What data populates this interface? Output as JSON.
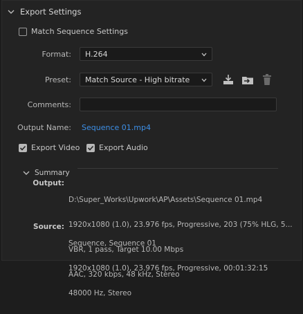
{
  "section_title": "Export Settings",
  "match_sequence": {
    "label": "Match Sequence Settings",
    "checked": false
  },
  "format": {
    "label": "Format:",
    "value": "H.264"
  },
  "preset": {
    "label": "Preset:",
    "value": "Match Source - High bitrate"
  },
  "comments": {
    "label": "Comments:",
    "value": ""
  },
  "output_name": {
    "label": "Output Name:",
    "value": "Sequence 01.mp4"
  },
  "export_video": {
    "label": "Export Video",
    "checked": true
  },
  "export_audio": {
    "label": "Export Audio",
    "checked": true
  },
  "summary": {
    "title": "Summary",
    "output_label": "Output:",
    "output_lines": [
      "D:\\Super_Works\\Upwork\\AP\\Assets\\Sequence 01.mp4",
      "1920x1080 (1.0), 23.976 fps, Progressive, 203 (75% HLG, 5...",
      "VBR, 1 pass, Target 10.00 Mbps",
      "AAC, 320 kbps, 48 kHz, Stereo"
    ],
    "source_label": "Source:",
    "source_lines": [
      "Sequence, Sequence 01",
      "1920x1080 (1.0), 23.976 fps, Progressive, 00:01:32:15",
      "48000 Hz, Stereo"
    ]
  },
  "icons": [
    "chevron-down-icon",
    "save-preset-icon",
    "import-preset-icon",
    "delete-preset-icon"
  ],
  "colors": {
    "accent_link": "#3d8fe6",
    "panel_bg": "#232323"
  }
}
